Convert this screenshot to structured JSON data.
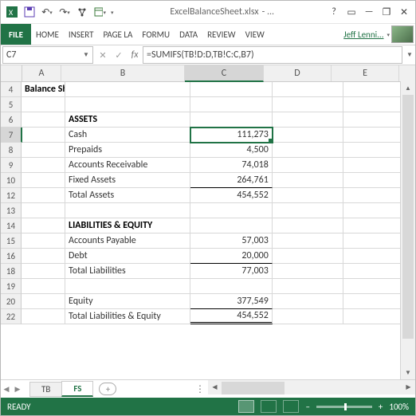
{
  "window": {
    "title_file": "ExcelBalanceSheet.xlsx",
    "title_suffix": " - ..."
  },
  "ribbon": {
    "file": "FILE",
    "tabs": [
      "HOME",
      "INSERT",
      "PAGE LA",
      "FORMU",
      "DATA",
      "REVIEW",
      "VIEW"
    ],
    "user": "Jeff Lenni..."
  },
  "formula_bar": {
    "name_box": "C7",
    "fx": "fx",
    "formula": "=SUMIFS(TB!D:D,TB!C:C,B7)"
  },
  "columns": [
    "A",
    "B",
    "C",
    "D",
    "E"
  ],
  "selected_col": "C",
  "selected_row": "7",
  "rows": [
    {
      "n": "4",
      "A": "Balance Sheet",
      "boldA": true
    },
    {
      "n": "5"
    },
    {
      "n": "6",
      "B": "ASSETS",
      "boldB": true
    },
    {
      "n": "7",
      "B": "Cash",
      "C": "111,273",
      "sel": true
    },
    {
      "n": "8",
      "B": "Prepaids",
      "C": "4,500"
    },
    {
      "n": "9",
      "B": "Accounts Receivable",
      "C": "74,018"
    },
    {
      "n": "10",
      "B": "Fixed Assets",
      "C": "264,761"
    },
    {
      "n": "12",
      "B": "  Total Assets",
      "C": "454,552",
      "topline": true
    },
    {
      "n": "13"
    },
    {
      "n": "14",
      "B": "LIABILITIES & EQUITY",
      "boldB": true
    },
    {
      "n": "15",
      "B": "Accounts Payable",
      "C": "57,003"
    },
    {
      "n": "16",
      "B": "Debt",
      "C": "20,000"
    },
    {
      "n": "18",
      "B": "Total Liabilities",
      "C": "77,003",
      "topline": true
    },
    {
      "n": "19"
    },
    {
      "n": "20",
      "B": "Equity",
      "C": "377,549"
    },
    {
      "n": "22",
      "B": "Total Liabilities & Equity",
      "C": "454,552",
      "topline": true,
      "dbl": true
    }
  ],
  "sheets": {
    "tabs": [
      "TB",
      "FS"
    ],
    "active": "FS"
  },
  "status": {
    "ready": "READY",
    "zoom": "100%"
  }
}
